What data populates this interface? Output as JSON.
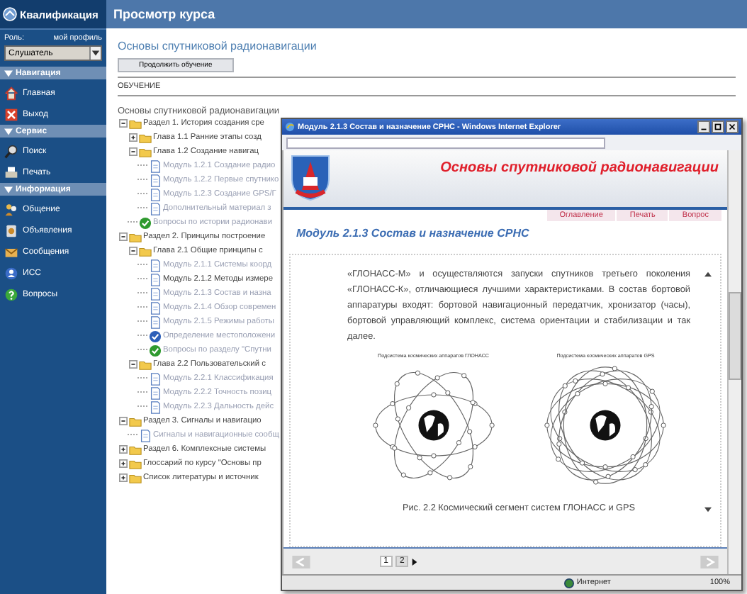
{
  "app": {
    "logo": "Квалификация",
    "role_label": "Роль:",
    "profile_link": "мой профиль",
    "role": "Слушатель"
  },
  "sidebar": {
    "sections": [
      {
        "title": "Навигация",
        "expanded": true,
        "items": [
          "Главная",
          "Выход"
        ]
      },
      {
        "title": "Сервис",
        "expanded": true,
        "items": [
          "Поиск",
          "Печать"
        ]
      },
      {
        "title": "Информация",
        "expanded": true,
        "items": [
          "Общение",
          "Объявления",
          "Сообщения",
          "ИСС",
          "Вопросы"
        ]
      }
    ]
  },
  "page": {
    "title": "Просмотр курса"
  },
  "course": {
    "title": "Основы спутниковой радионавигации",
    "continue_button": "Продолжить обучение",
    "section_label": "ОБУЧЕНИЕ",
    "root": "Основы спутниковой радионавигации",
    "tree": [
      {
        "kind": "folder",
        "label": "Раздел 1. История создания сре",
        "expanded": true,
        "children": [
          {
            "kind": "folder",
            "label": "Глава 1.1 Ранние этапы созд",
            "expanded": false
          },
          {
            "kind": "folder",
            "label": "Глава 1.2 Создание навигац",
            "expanded": true,
            "children": [
              {
                "kind": "page",
                "label": "Модуль 1.2.1 Создание радио",
                "available": false
              },
              {
                "kind": "page",
                "label": "Модуль 1.2.2 Первые спутнико",
                "available": false
              },
              {
                "kind": "page",
                "label": "Модуль 1.2.3 Создание GPS/Г",
                "available": false
              },
              {
                "kind": "page",
                "label": "Дополнительный материал з",
                "available": false
              }
            ]
          },
          {
            "kind": "test",
            "label": "Вопросы по истории радионави",
            "available": false
          }
        ]
      },
      {
        "kind": "folder",
        "label": "Раздел 2. Принципы построение",
        "expanded": true,
        "children": [
          {
            "kind": "folder",
            "label": "Глава 2.1 Общие принципы с",
            "expanded": true,
            "children": [
              {
                "kind": "page",
                "label": "Модуль 2.1.1 Системы коорд",
                "available": false
              },
              {
                "kind": "page",
                "label": "Модуль 2.1.2 Методы измере",
                "available": true
              },
              {
                "kind": "page",
                "label": "Модуль 2.1.3 Состав и назна",
                "available": false
              },
              {
                "kind": "page",
                "label": "Модуль 2.1.4 Обзор современ",
                "available": false
              },
              {
                "kind": "page",
                "label": "Модуль 2.1.5 Режимы работы",
                "available": false
              },
              {
                "kind": "task",
                "label": "Определение местоположени",
                "available": false
              },
              {
                "kind": "test",
                "label": "Вопросы по разделу \"Спутни",
                "available": false
              }
            ]
          },
          {
            "kind": "folder",
            "label": "Глава 2.2 Пользовательский с",
            "expanded": true,
            "children": [
              {
                "kind": "page",
                "label": "Модуль 2.2.1 Классификация",
                "available": false
              },
              {
                "kind": "page",
                "label": "Модуль 2.2.2 Точность позиц",
                "available": false
              },
              {
                "kind": "page",
                "label": "Модуль 2.2.3 Дальность дейс",
                "available": false
              }
            ]
          }
        ]
      },
      {
        "kind": "folder",
        "label": "Раздел 3. Сигналы и навигацио",
        "expanded": true,
        "children": [
          {
            "kind": "page",
            "label": "Сигналы и навигационные сообщ",
            "available": false
          }
        ]
      },
      {
        "kind": "folder",
        "label": "Раздел 6. Комплексные системы",
        "expanded": false
      },
      {
        "kind": "folder",
        "label": "Глоссарий по курсу \"Основы пр",
        "expanded": false
      },
      {
        "kind": "folder",
        "label": "Список литературы и источник",
        "expanded": false
      }
    ]
  },
  "popup": {
    "window_title": "Модуль 2.1.3 Состав и назначение СРНС - Windows Internet Explorer",
    "course_title": "Основы спутниковой радионавигации",
    "links": [
      "Оглавление",
      "Печать",
      "Вопрос"
    ],
    "module_title": "Модуль 2.1.3 Состав и назначение СРНС",
    "paragraph": "«ГЛОНАСС-М» и осуществляются запуски спутников третьего поколения «ГЛОНАСС-К», отличающиеся лучшими характеристиками. В состав бортовой аппаратуры входят: бортовой навигационный передатчик, хронизатор (часы), бортовой управляющий комплекс, система ориентации и стабилизации и так далее.",
    "figures": [
      {
        "kind": "glonass",
        "label": "Подсистема космических аппаратов ГЛОНАСС"
      },
      {
        "kind": "gps",
        "label": "Подсистема космических аппаратов  GPS"
      }
    ],
    "figure_caption": "Рис. 2.2 Космический сегмент систем ГЛОНАСС и GPS",
    "pages": [
      {
        "label": "1",
        "selected": true
      },
      {
        "label": "2",
        "selected": false
      }
    ],
    "status": "Интернет",
    "zoom": "100%"
  }
}
